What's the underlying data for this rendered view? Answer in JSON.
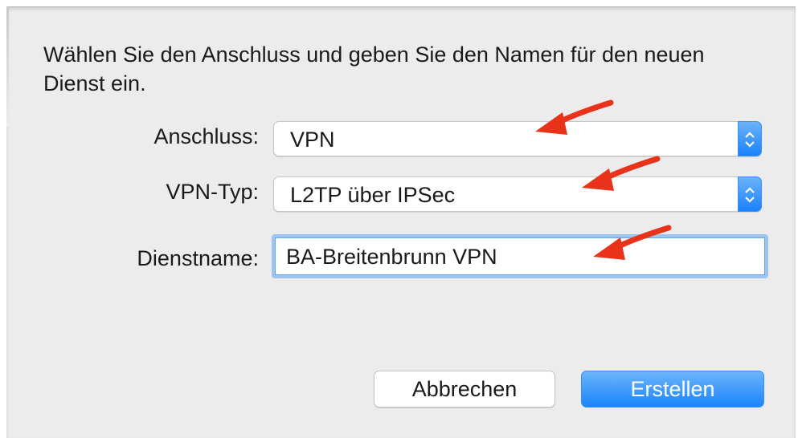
{
  "dialog": {
    "prompt": "Wählen Sie den Anschluss und geben Sie den Namen für den neuen Dienst ein.",
    "interface": {
      "label": "Anschluss:",
      "value": "VPN"
    },
    "vpn_type": {
      "label": "VPN-Typ:",
      "value": "L2TP über IPSec"
    },
    "service_name": {
      "label": "Dienstname:",
      "value": "BA-Breitenbrunn VPN"
    },
    "buttons": {
      "cancel": "Abbrechen",
      "create": "Erstellen"
    }
  },
  "annotations": {
    "arrow_color": "#e8321a",
    "arrow_count": 3
  },
  "colors": {
    "accent": "#1a82fb",
    "focus_ring": "#9ec5f0",
    "background": "#ececec"
  }
}
